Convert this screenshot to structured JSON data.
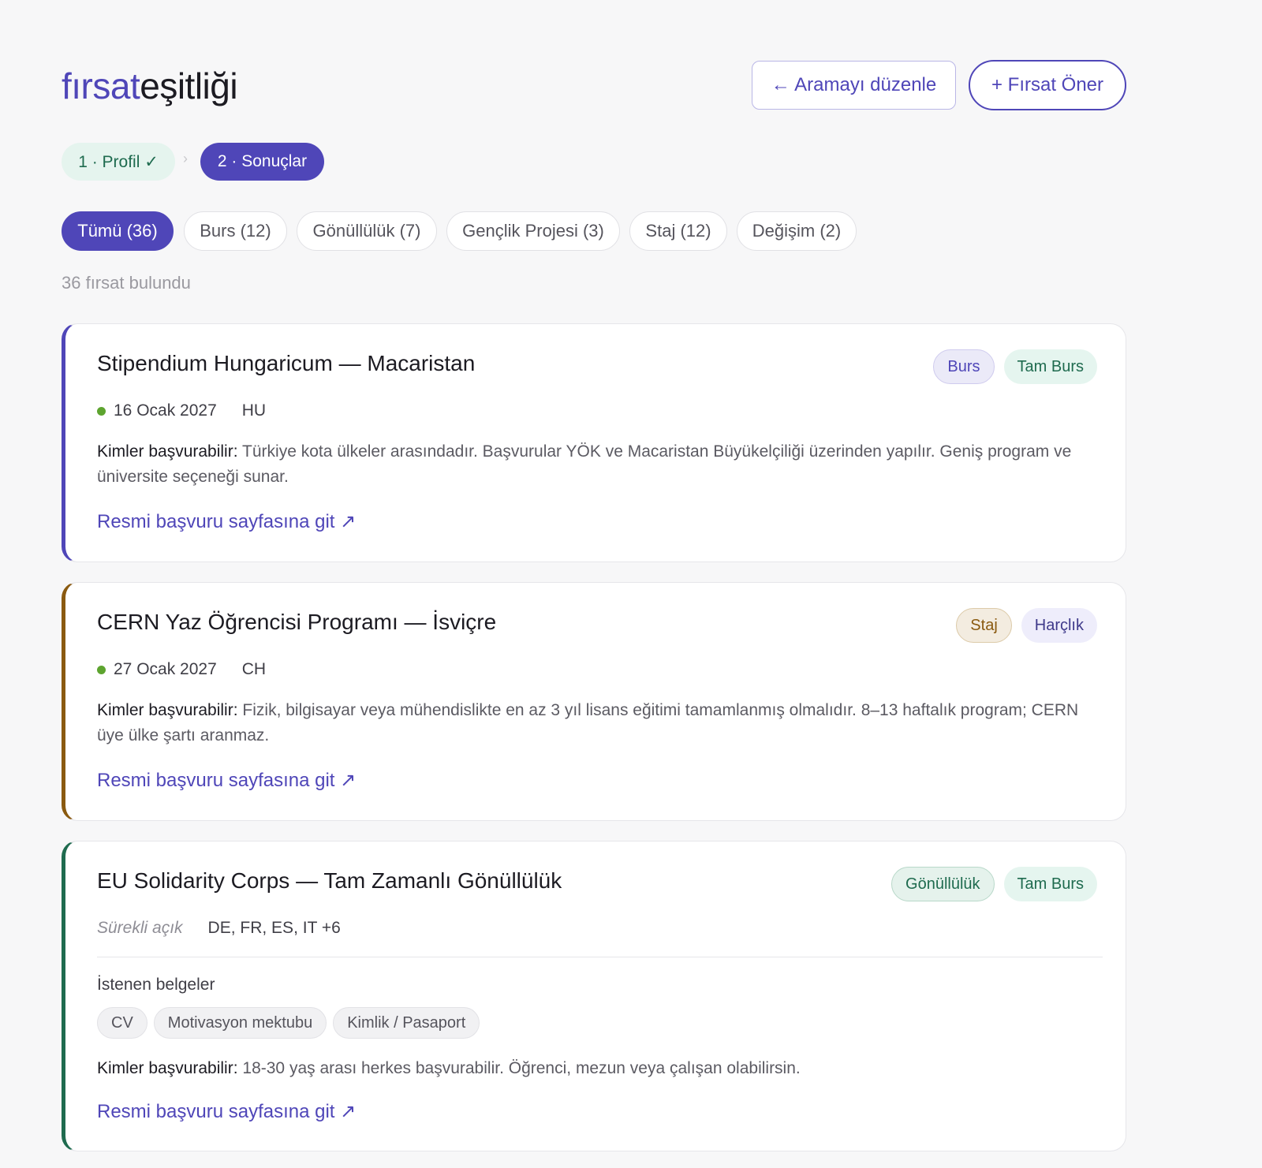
{
  "brand": {
    "part1": "fırsat",
    "part2": "eşitliği"
  },
  "header": {
    "edit_button": "← Aramayı düzenle",
    "suggest_button": "+ Fırsat Öner"
  },
  "steps": {
    "step1": "1 · Profil ✓",
    "separator": "›",
    "step2": "2 · Sonuçlar"
  },
  "filters": [
    "Tümü (36)",
    "Burs (12)",
    "Gönüllülük (7)",
    "Gençlik Projesi (3)",
    "Staj (12)",
    "Değişim (2)"
  ],
  "result_count": "36 fırsat bulundu",
  "colors": {
    "accent": "#4f46b8",
    "burs_border": "#4f46b8",
    "staj_border": "#8a5a10",
    "gonulluluk_border": "#1f6b4f",
    "open_dot": "#5da42f"
  },
  "who_label": "Kimler başvurabilir:",
  "link_label": "Resmi başvuru sayfasına git ↗",
  "cards": [
    {
      "title": "Stipendium Hungaricum — Macaristan",
      "tags": [
        "Burs",
        "Tam Burs"
      ],
      "deadline": "16 Ocak 2027",
      "countries": "HU",
      "description": "Türkiye kota ülkeler arasındadır. Başvurular YÖK ve Macaristan Büyükelçiliği üzerinden yapılır. Geniş program ve üniversite seçeneği sunar."
    },
    {
      "title": "CERN Yaz Öğrencisi Programı — İsviçre",
      "tags": [
        "Staj",
        "Harçlık"
      ],
      "deadline": "27 Ocak 2027",
      "countries": "CH",
      "description": "Fizik, bilgisayar veya mühendislikte en az 3 yıl lisans eğitimi tamamlanmış olmalıdır. 8–13 haftalık program; CERN üye ülke şartı aranmaz."
    },
    {
      "title": "EU Solidarity Corps — Tam Zamanlı Gönüllülük",
      "tags": [
        "Gönüllülük",
        "Tam Burs"
      ],
      "deadline": "Sürekli açık",
      "countries": "DE, FR, ES, IT +6",
      "documents_label": "İstenen belgeler",
      "documents": [
        "CV",
        "Motivasyon mektubu",
        "Kimlik / Pasaport"
      ],
      "description": "18-30 yaş arası herkes başvurabilir. Öğrenci, mezun veya çalışan olabilirsin."
    }
  ]
}
